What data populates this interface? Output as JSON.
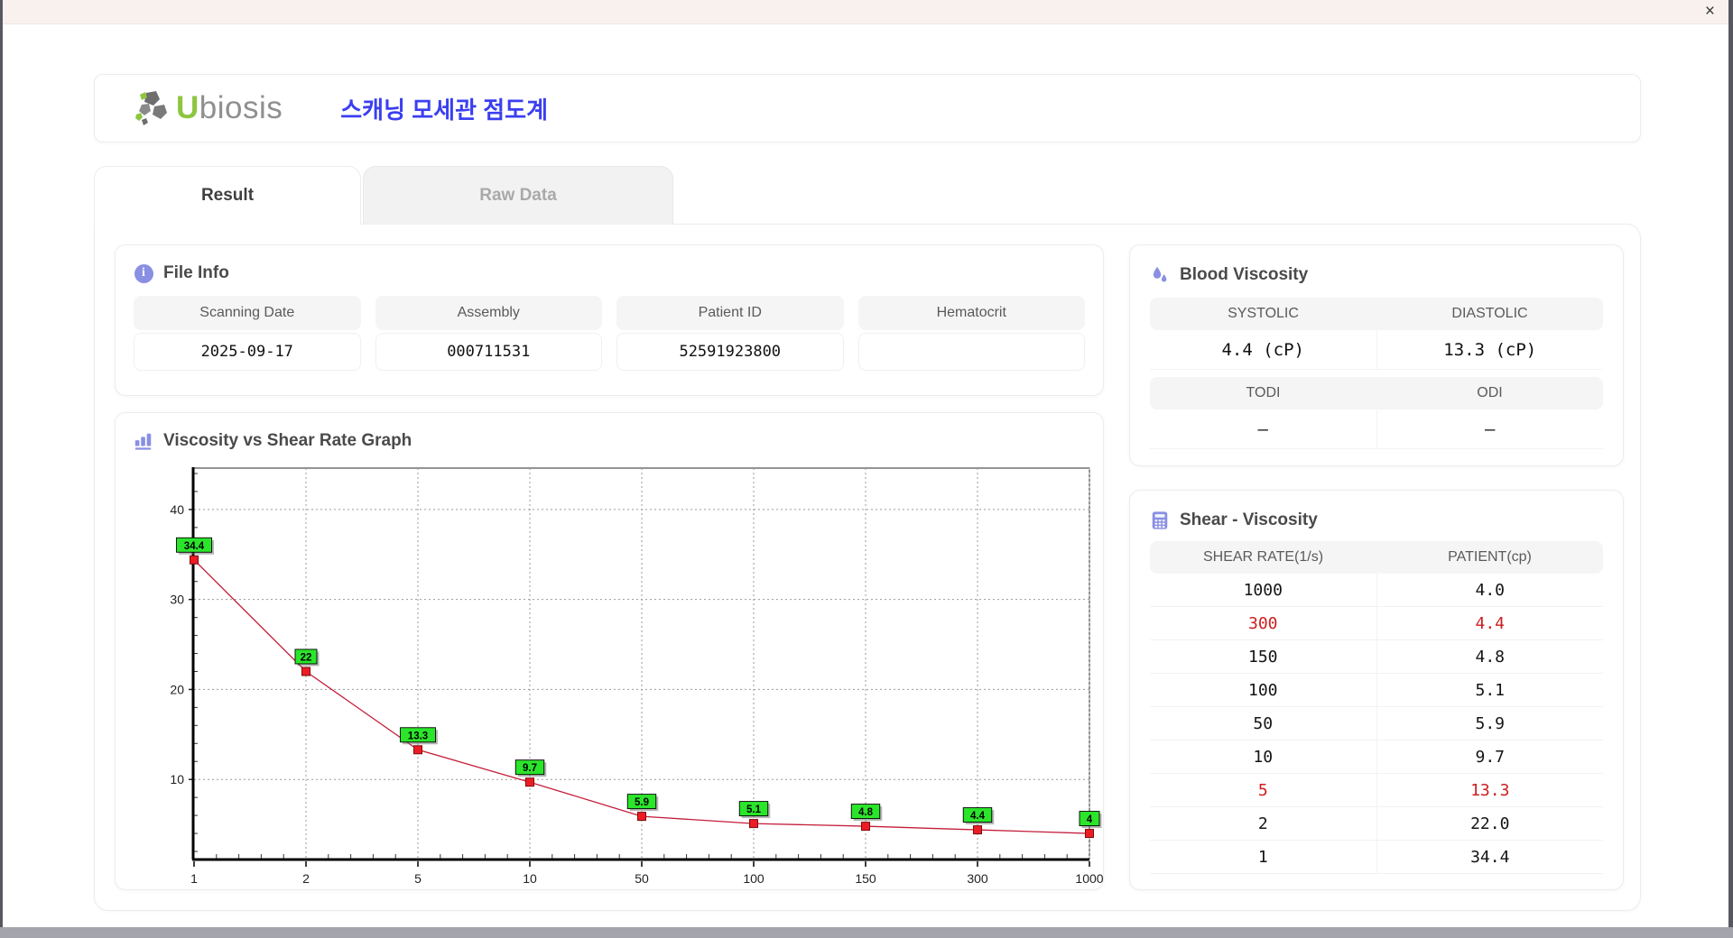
{
  "window": {
    "close_glyph": "×"
  },
  "header": {
    "logo_u": "U",
    "logo_rest": "biosis",
    "app_title": "스캐닝 모세관 점도계"
  },
  "tabs": [
    {
      "label": "Result",
      "active": true
    },
    {
      "label": "Raw Data",
      "active": false
    }
  ],
  "file_info": {
    "title": "File Info",
    "fields": [
      {
        "label": "Scanning Date",
        "value": "2025-09-17"
      },
      {
        "label": "Assembly",
        "value": "000711531"
      },
      {
        "label": "Patient ID",
        "value": "52591923800"
      },
      {
        "label": "Hematocrit",
        "value": ""
      }
    ]
  },
  "blood_viscosity": {
    "title": "Blood Viscosity",
    "rows": [
      [
        {
          "label": "SYSTOLIC",
          "value": "4.4 (cP)"
        },
        {
          "label": "DIASTOLIC",
          "value": "13.3 (cP)"
        }
      ],
      [
        {
          "label": "TODI",
          "value": "–"
        },
        {
          "label": "ODI",
          "value": "–"
        }
      ]
    ]
  },
  "shear_viscosity": {
    "title": "Shear - Viscosity",
    "columns": [
      "SHEAR RATE(1/s)",
      "PATIENT(cp)"
    ],
    "rows": [
      {
        "shear_rate": "1000",
        "patient": "4.0",
        "highlight": false
      },
      {
        "shear_rate": "300",
        "patient": "4.4",
        "highlight": true
      },
      {
        "shear_rate": "150",
        "patient": "4.8",
        "highlight": false
      },
      {
        "shear_rate": "100",
        "patient": "5.1",
        "highlight": false
      },
      {
        "shear_rate": "50",
        "patient": "5.9",
        "highlight": false
      },
      {
        "shear_rate": "10",
        "patient": "9.7",
        "highlight": false
      },
      {
        "shear_rate": "5",
        "patient": "13.3",
        "highlight": true
      },
      {
        "shear_rate": "2",
        "patient": "22.0",
        "highlight": false
      },
      {
        "shear_rate": "1",
        "patient": "34.4",
        "highlight": false
      }
    ]
  },
  "chart_data": {
    "type": "line",
    "title": "Viscosity vs Shear Rate Graph",
    "x": [
      1,
      2,
      5,
      10,
      50,
      100,
      150,
      300,
      1000
    ],
    "y": [
      34.4,
      22,
      13.3,
      9.7,
      5.9,
      5.1,
      4.8,
      4.4,
      4
    ],
    "point_labels": [
      "34.4",
      "22",
      "13.3",
      "9.7",
      "5.9",
      "5.1",
      "4.8",
      "4.4",
      "4"
    ],
    "x_tick_labels": [
      "1",
      "2",
      "5",
      "10",
      "50",
      "100",
      "150",
      "300",
      "1000"
    ],
    "y_ticks": [
      10,
      20,
      30,
      40
    ],
    "ylim": [
      1.2,
      44.6
    ],
    "x_scale": "category",
    "grid": true,
    "xlabel": "",
    "ylabel": ""
  },
  "colors": {
    "accent_purple": "#898fe3",
    "brand_green": "#8dc63f",
    "brand_gray": "#8f8f8f",
    "title_blue": "#3a3ff0",
    "highlight_red": "#cb1f1f",
    "chart_line": "#c41e3a",
    "chart_marker": "#ed1c24",
    "chart_marker_border": "#7a0c10",
    "chart_label_bg": "#2be52b"
  }
}
